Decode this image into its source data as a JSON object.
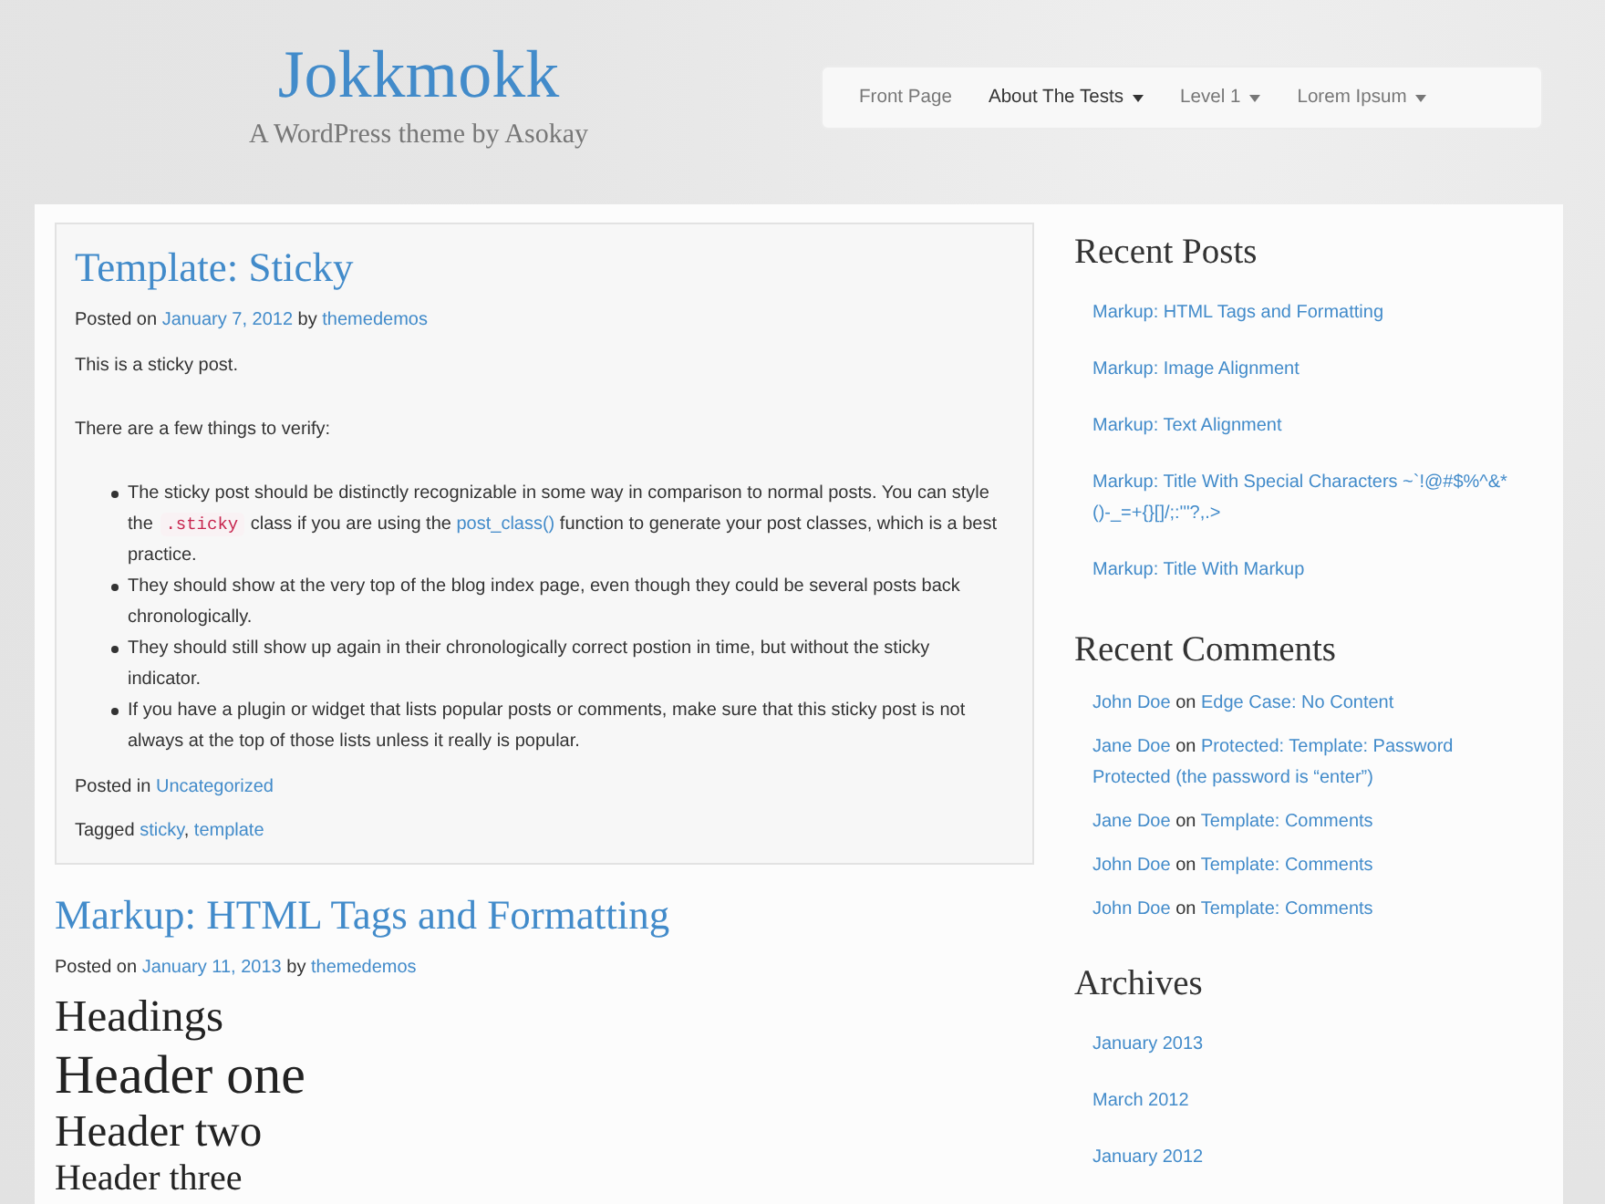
{
  "site": {
    "title": "Jokkmokk",
    "tagline": "A WordPress theme by Asokay"
  },
  "nav": [
    {
      "label": "Front Page",
      "selected": false,
      "dropdown": false
    },
    {
      "label": "About The Tests",
      "selected": true,
      "dropdown": true
    },
    {
      "label": "Level 1",
      "selected": false,
      "dropdown": true
    },
    {
      "label": "Lorem Ipsum",
      "selected": false,
      "dropdown": true
    }
  ],
  "posts": [
    {
      "kind": "sticky",
      "title": "Template: Sticky",
      "meta": [
        {
          "kind": "text",
          "text": "Posted on "
        },
        {
          "kind": "link",
          "text": "January 7, 2012"
        },
        {
          "kind": "text",
          "text": " by "
        },
        {
          "kind": "link",
          "text": "themedemos"
        }
      ],
      "body": [
        {
          "kind": "paragraph",
          "text": "This is a sticky post."
        },
        {
          "kind": "paragraph",
          "text": "There are a few things to verify:"
        },
        {
          "kind": "bullets",
          "items": [
            [
              {
                "kind": "text",
                "text": "The sticky post should be distinctly recognizable in some way in comparison to normal posts. You can style the "
              },
              {
                "kind": "code",
                "text": ".sticky"
              },
              {
                "kind": "text",
                "text": " class if you are using the "
              },
              {
                "kind": "link",
                "text": "post_class()"
              },
              {
                "kind": "text",
                "text": " function to generate your post classes, which is a best practice."
              }
            ],
            [
              {
                "kind": "text",
                "text": "They should show at the very top of the blog index page, even though they could be several posts back chronologically."
              }
            ],
            [
              {
                "kind": "text",
                "text": "They should still show up again in their chronologically correct postion in time, but without the sticky indicator."
              }
            ],
            [
              {
                "kind": "text",
                "text": "If you have a plugin or widget that lists popular posts or comments, make sure that this sticky post is not always at the top of those lists unless it really is popular."
              }
            ]
          ]
        }
      ],
      "footer": [
        [
          {
            "kind": "text",
            "text": "Posted in "
          },
          {
            "kind": "link",
            "text": "Uncategorized"
          }
        ],
        [
          {
            "kind": "text",
            "text": "Tagged "
          },
          {
            "kind": "link",
            "text": "sticky"
          },
          {
            "kind": "text",
            "text": ", "
          },
          {
            "kind": "link",
            "text": "template"
          }
        ]
      ]
    },
    {
      "kind": "standard",
      "title": "Markup: HTML Tags and Formatting",
      "meta": [
        {
          "kind": "text",
          "text": "Posted on "
        },
        {
          "kind": "link",
          "text": "January 11, 2013"
        },
        {
          "kind": "text",
          "text": " by "
        },
        {
          "kind": "link",
          "text": "themedemos"
        }
      ],
      "body": [
        {
          "kind": "h2",
          "text": "Headings"
        },
        {
          "kind": "h1",
          "text": "Header one"
        },
        {
          "kind": "h2",
          "text": "Header two"
        },
        {
          "kind": "h3",
          "text": "Header three"
        }
      ]
    }
  ],
  "sidebar": [
    {
      "kind": "links",
      "title": "Recent Posts",
      "items": [
        "Markup: HTML Tags and Formatting",
        "Markup: Image Alignment",
        "Markup: Text Alignment",
        "Markup: Title With Special Characters ~`!@#$%^&*()-_=+{}[]/;:'\"?,.>",
        "Markup: Title With Markup"
      ]
    },
    {
      "kind": "comments",
      "title": "Recent Comments",
      "items": [
        [
          {
            "kind": "link",
            "text": "John Doe"
          },
          {
            "kind": "text",
            "text": " on "
          },
          {
            "kind": "link",
            "text": "Edge Case: No Content"
          }
        ],
        [
          {
            "kind": "link",
            "text": "Jane Doe"
          },
          {
            "kind": "text",
            "text": " on "
          },
          {
            "kind": "link",
            "text": "Protected: Template: Password Protected (the password is “enter”)"
          }
        ],
        [
          {
            "kind": "link",
            "text": "Jane Doe"
          },
          {
            "kind": "text",
            "text": " on "
          },
          {
            "kind": "link",
            "text": "Template: Comments"
          }
        ],
        [
          {
            "kind": "link",
            "text": "John Doe"
          },
          {
            "kind": "text",
            "text": " on "
          },
          {
            "kind": "link",
            "text": "Template: Comments"
          }
        ],
        [
          {
            "kind": "link",
            "text": "John Doe"
          },
          {
            "kind": "text",
            "text": " on "
          },
          {
            "kind": "link",
            "text": "Template: Comments"
          }
        ]
      ]
    },
    {
      "kind": "links",
      "title": "Archives",
      "items": [
        "January 2013",
        "March 2012",
        "January 2012"
      ]
    }
  ]
}
